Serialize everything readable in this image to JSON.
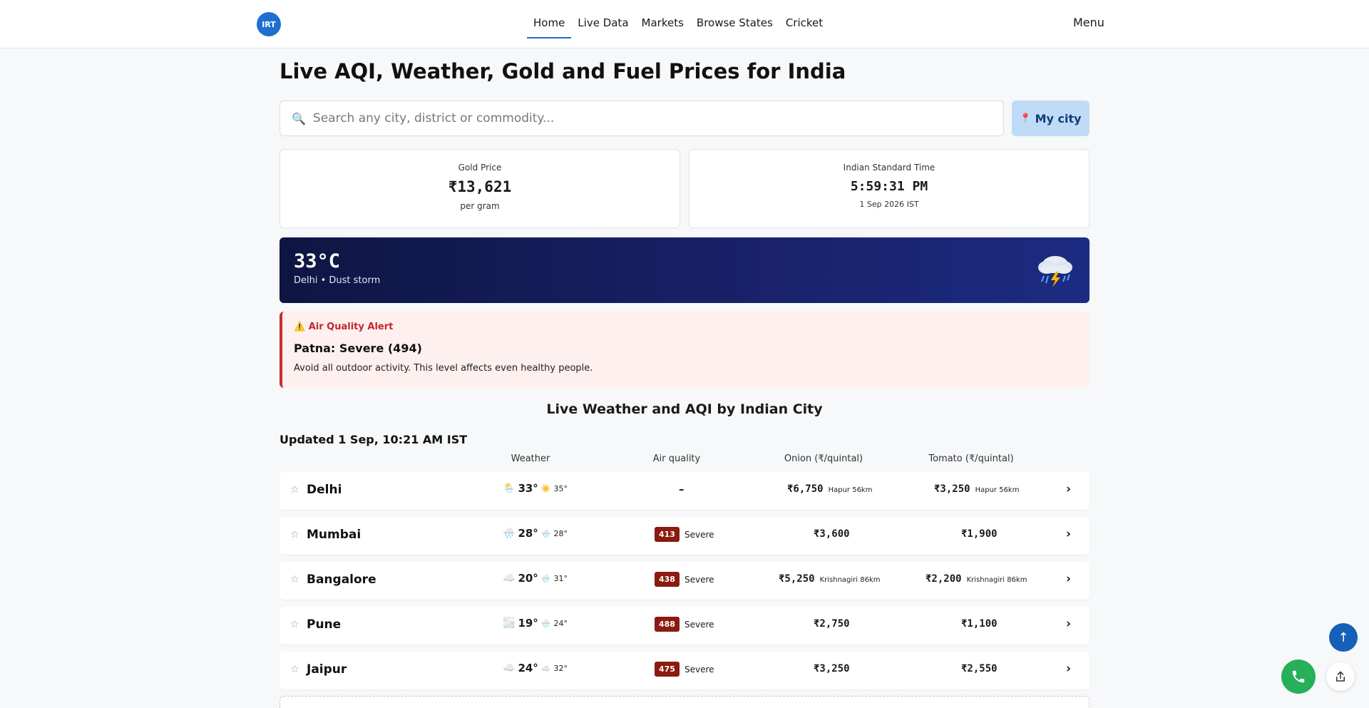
{
  "header": {
    "logo_text": "IRT",
    "nav": [
      "Home",
      "Live Data",
      "Markets",
      "Browse States",
      "Cricket"
    ],
    "menu_label": "Menu"
  },
  "page_title": "Live AQI, Weather, Gold and Fuel Prices for India",
  "search": {
    "icon": "search-icon",
    "placeholder": "Search any city, district or commodity...",
    "my_city_label": "My city"
  },
  "gold": {
    "label": "Gold Price",
    "value": "₹13,621",
    "unit": "per gram"
  },
  "ist": {
    "label": "Indian Standard Time",
    "time": "5:59:31 PM",
    "date": "1 Sep 2026 IST"
  },
  "weather": {
    "temp": "33°C",
    "place": "Delhi • Dust storm",
    "icon": "thunderstorm-icon"
  },
  "alert": {
    "heading": "Air Quality Alert",
    "title": "Patna: Severe (494)",
    "text": "Avoid all outdoor activity. This level affects even healthy people."
  },
  "section_title": "Live Weather and AQI by Indian City",
  "updated": "Updated 1 Sep, 10:21 AM IST",
  "columns": [
    "Weather",
    "Air quality",
    "Onion (₹/quintal)",
    "Tomato (₹/quintal)"
  ],
  "rows": [
    {
      "city": "Delhi",
      "wx_icon": "rain-cloud-icon",
      "temp": "33°",
      "wx2_icon": "sun-icon",
      "temp2": "35°",
      "aqi": "–",
      "aqi_label": "",
      "onion": "₹6,750",
      "onion_note": "Hapur 56km",
      "tomato": "₹3,250",
      "tomato_note": "Hapur 56km"
    },
    {
      "city": "Mumbai",
      "wx_icon": "rain-cloud-icon",
      "temp": "28°",
      "wx2_icon": "rain-cloud-icon",
      "temp2": "28°",
      "aqi": "413",
      "aqi_label": "Severe",
      "onion": "₹3,600",
      "onion_note": "",
      "tomato": "₹1,900",
      "tomato_note": ""
    },
    {
      "city": "Bangalore",
      "wx_icon": "cloud-icon",
      "temp": "20°",
      "wx2_icon": "rain-cloud-icon",
      "temp2": "31°",
      "aqi": "438",
      "aqi_label": "Severe",
      "onion": "₹5,250",
      "onion_note": "Krishnagiri 86km",
      "tomato": "₹2,200",
      "tomato_note": "Krishnagiri 86km"
    },
    {
      "city": "Pune",
      "wx_icon": "fog-icon",
      "temp": "19°",
      "wx2_icon": "rain-cloud-icon",
      "temp2": "24°",
      "aqi": "488",
      "aqi_label": "Severe",
      "onion": "₹2,750",
      "onion_note": "",
      "tomato": "₹1,100",
      "tomato_note": ""
    },
    {
      "city": "Jaipur",
      "wx_icon": "cloud-icon",
      "temp": "24°",
      "wx2_icon": "cloud-icon",
      "temp2": "32°",
      "aqi": "475",
      "aqi_label": "Severe",
      "onion": "₹3,250",
      "onion_note": "",
      "tomato": "₹2,550",
      "tomato_note": ""
    }
  ],
  "colors": {
    "accent": "#1f6fd1",
    "severe": "#8b1a10",
    "banner": "#19226a",
    "alert": "#c9302c",
    "call": "#26b05a"
  }
}
